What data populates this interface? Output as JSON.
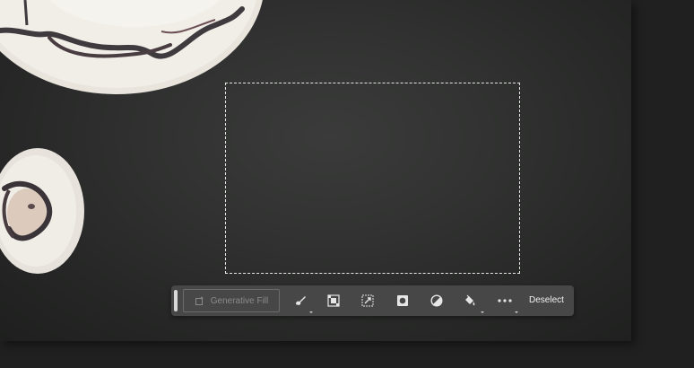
{
  "taskbar": {
    "generative_fill_label": "Generative Fill",
    "deselect_label": "Deselect",
    "tools": [
      {
        "name": "modify-selection-icon"
      },
      {
        "name": "invert-selection-icon"
      },
      {
        "name": "transform-selection-icon"
      },
      {
        "name": "create-mask-icon"
      },
      {
        "name": "adjustment-layer-icon"
      },
      {
        "name": "fill-selection-icon"
      },
      {
        "name": "more-options-icon"
      }
    ]
  },
  "colors": {
    "taskbar_bg": "#474747",
    "canvas_bg": "#313231",
    "selection_marquee": "#e6e6e6"
  }
}
